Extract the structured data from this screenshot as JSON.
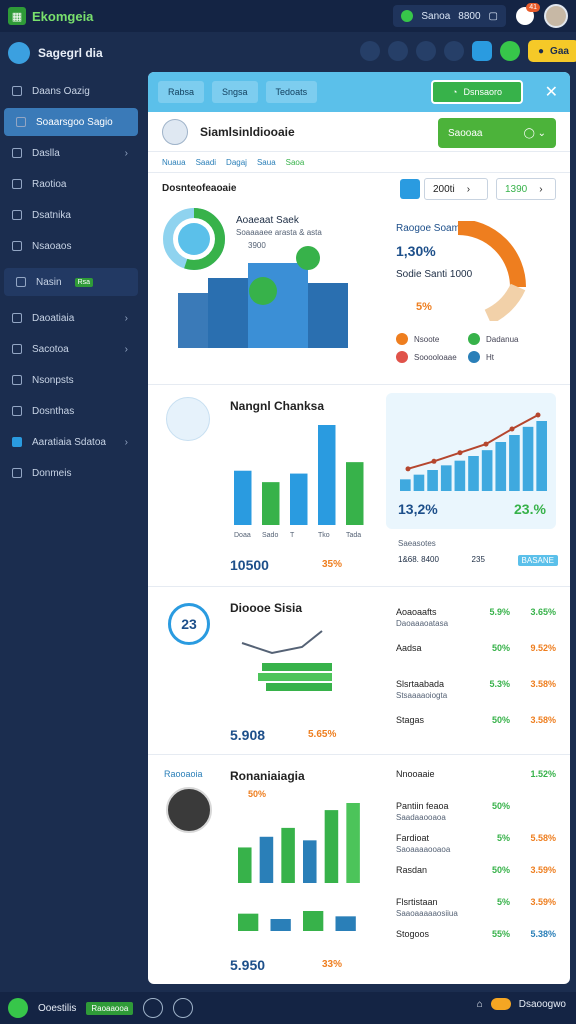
{
  "app": {
    "title": "Ekomgeia"
  },
  "topbar": {
    "pill_label": "Sanoa",
    "pill_value": "8800",
    "notif_count": "41"
  },
  "sidebar": {
    "header": "Sagegrl dia",
    "items": [
      {
        "label": "Daans Oazig",
        "chevron": false
      },
      {
        "label": "Soaarsgoo Sagio",
        "chevron": false,
        "active": true
      },
      {
        "label": "Daslla",
        "chevron": true
      },
      {
        "label": "Raotioa",
        "chevron": false
      },
      {
        "label": "Dsatnika",
        "chevron": false
      },
      {
        "label": "Nsaoaos",
        "chevron": false
      },
      {
        "label": "Nasin",
        "tag": "Rsa",
        "chevron": false,
        "boxed": true
      },
      {
        "label": "Daoatiaia",
        "chevron": true
      },
      {
        "label": "Sacotoa",
        "chevron": true
      },
      {
        "label": "Nsonpsts",
        "chevron": false
      },
      {
        "label": "Dosnthas",
        "chevron": false
      },
      {
        "label": "Aaratiaia Sdatoa",
        "chevron": true,
        "highlight": true
      },
      {
        "label": "Donmeis",
        "chevron": false
      }
    ]
  },
  "toolbar": {
    "yellow_label": "Gaa"
  },
  "panel": {
    "tabs": [
      "Rabsa",
      "Sngsa",
      "Tedoats"
    ],
    "green_btn": "Dsnsaoro",
    "title": "Siamlsinldiooaie",
    "title_btn": "Saooaa",
    "subtabs": [
      "Nuaua",
      "Saadi",
      "Dagaj",
      "Saua",
      "Saoa"
    ],
    "sec1": {
      "title": "Dosnteofeaoaie",
      "select1": "200ti",
      "select2": "1390",
      "subtitle": "Aoaeaat Saek",
      "subtitle_small": "Soaaaaee arasta & asta",
      "ring_small": "3900",
      "right_title": "Raogoe Soamt",
      "right_pct": "1,30%",
      "right_label": "Sodie Santi 1000",
      "right_pct2": "5%",
      "legend": [
        {
          "label": "Nsoote",
          "color": "#ee7e1f"
        },
        {
          "label": "Sooooloaae",
          "color": "#e0534a"
        },
        {
          "label": "Dadanua",
          "color": "#37b24a"
        },
        {
          "label": "Ht",
          "color": "#2a7fb8"
        }
      ],
      "gauge_value": 0.72
    },
    "sec2": {
      "title": "Nangnl Chanksa",
      "bars": [
        38,
        30,
        36,
        70,
        44
      ],
      "bars_labels": [
        "Doaa",
        "Sado",
        "T",
        "Tko",
        "Tada"
      ],
      "bottom_num": "10500",
      "bottom_pct": "35%",
      "right_big": "13,2%",
      "right_big2": "23.%",
      "right_small": "Saeasotes",
      "line_values": [
        15,
        22,
        30,
        38,
        52,
        65
      ],
      "right_bars": [
        10,
        14,
        18,
        22,
        26,
        30,
        35,
        42,
        48,
        55,
        60
      ],
      "right_bottom_label": "1&68. 8400",
      "right_bottom_val": "235",
      "right_bottom_tag": "BASANE"
    },
    "sec3": {
      "title": "Dioooe Sisia",
      "badge": "23",
      "bottom_num": "5.908",
      "bottom_pct": "5.65%",
      "stats": [
        {
          "label": "Aoaoaafts",
          "sub": "Daoaaaoatasa",
          "v1": "5.9%",
          "v2": "3.65%",
          "c2": "#37b24a"
        },
        {
          "label": "Aadsa",
          "sub": "",
          "v1": "50%",
          "v2": "9.52%",
          "c2": "#ee7e1f"
        },
        {
          "label": "Slsrtaabada",
          "sub": "Stsaaaaoiogta",
          "v1": "5.3%",
          "v2": "3.58%",
          "c2": "#ee7e1f"
        },
        {
          "label": "Stagas",
          "sub": "",
          "v1": "50%",
          "v2": "3.58%",
          "c2": "#ee7e1f"
        }
      ]
    },
    "sec4": {
      "left_label": "Raooaoia",
      "title": "Ronaniaiagia",
      "pct": "50%",
      "bars": [
        40,
        52,
        62,
        48,
        82,
        90
      ],
      "bars2": [
        26,
        18,
        30,
        22
      ],
      "bottom_num": "5.950",
      "bottom_pct": "33%",
      "stats": [
        {
          "label": "Nnooaaie",
          "sub": "",
          "v1": "",
          "v2": "1.52%",
          "c2": "#37b24a"
        },
        {
          "label": "Pantiin feaoa",
          "sub": "Saadaaooaoa",
          "v1": "50%",
          "v2": "",
          "c2": "#37b24a"
        },
        {
          "label": "Fardioat",
          "sub": "Saoaaaaooaoa",
          "v1": "5%",
          "v2": "5.58%",
          "c2": "#ee7e1f"
        },
        {
          "label": "Rasdan",
          "sub": "",
          "v1": "50%",
          "v2": "3.59%",
          "c2": "#ee7e1f"
        },
        {
          "label": "Flsrtistaan",
          "sub": "Saaoaaaaaosiiua",
          "v1": "5%",
          "v2": "3.59%",
          "c2": "#ee7e1f"
        },
        {
          "label": "Stogoos",
          "sub": "",
          "v1": "55%",
          "v2": "5.38%",
          "c2": "#2a7fb8"
        }
      ]
    }
  },
  "bottombar": {
    "label": "Ooestilis",
    "tag": "Raoaaooa",
    "right_label": "Dsaoogwo"
  }
}
